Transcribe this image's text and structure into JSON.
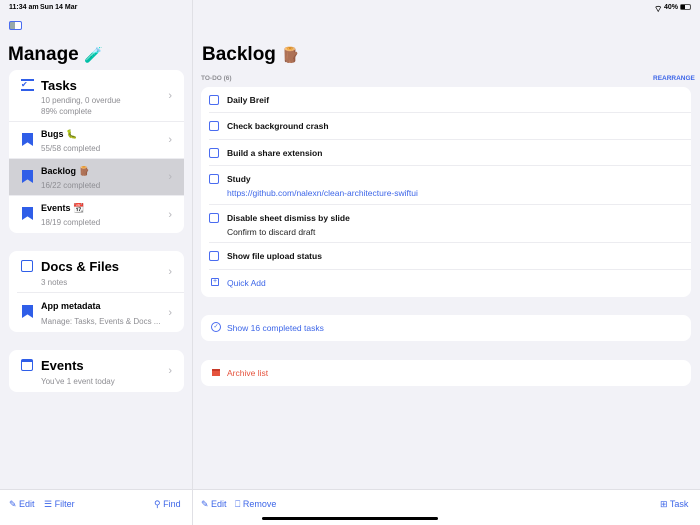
{
  "status_bar": {
    "time": "11:34 am",
    "date": "Sun 14 Mar",
    "battery": "40%"
  },
  "sidebar": {
    "title": "Manage",
    "title_emoji": "🧪",
    "lists": [
      {
        "title": "Tasks",
        "line1": "10 pending, 0 overdue",
        "line2": "89% complete"
      },
      {
        "title": "Bugs",
        "emoji": "🐛",
        "subtitle": "55/58 completed"
      },
      {
        "title": "Backlog",
        "emoji": "🪵",
        "subtitle": "16/22 completed",
        "selected": true
      },
      {
        "title": "Events",
        "emoji": "📆",
        "subtitle": "18/19 completed"
      }
    ],
    "docs": {
      "title": "Docs & Files",
      "subtitle": "3 notes"
    },
    "app_metadata": {
      "title": "App metadata",
      "subtitle": "Manage: Tasks, Events & Docs ..."
    },
    "events": {
      "title": "Events",
      "subtitle": "You've 1 event today"
    },
    "toolbar": {
      "edit": "Edit",
      "filter": "Filter",
      "find": "Find"
    }
  },
  "main": {
    "title": "Backlog",
    "title_emoji": "🪵",
    "section_label": "TO-DO (6)",
    "rearrange": "REARRANGE",
    "tasks": [
      {
        "title": "Daily Breif"
      },
      {
        "title": "Check background crash"
      },
      {
        "title": "Build a share extension"
      },
      {
        "title": "Study",
        "note": "https://github.com/nalexn/clean-architecture-swiftui"
      },
      {
        "title": "Disable sheet dismiss by slide",
        "note": "Confirm to discard draft"
      },
      {
        "title": "Show file upload status"
      }
    ],
    "quick_add": "Quick Add",
    "show_completed": "Show 16 completed tasks",
    "archive": "Archive list",
    "toolbar": {
      "edit": "Edit",
      "remove": "Remove",
      "task": "Task"
    }
  },
  "colors": {
    "accent": "#3d66e8",
    "danger": "#e5533d",
    "selected": "#d1d1d6",
    "background": "#f2f2f7"
  }
}
